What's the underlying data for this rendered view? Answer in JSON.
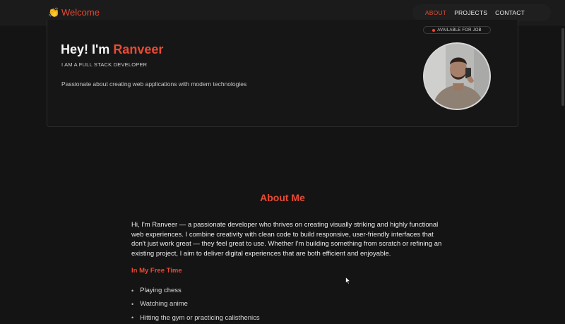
{
  "nav": {
    "brand_icon": "clapping-hands-icon",
    "brand": "Welcome",
    "links": [
      "ABOUT",
      "PROJECTS",
      "CONTACT"
    ],
    "active": "ABOUT"
  },
  "hero": {
    "greeting": "Hey! I'm ",
    "name": "Ranveer",
    "role": "I AM A FULL STACK DEVELOPER",
    "description": "Passionate about creating web applications with modern technologies",
    "badge": "AVAILABLE FOR JOB"
  },
  "about": {
    "heading": "About Me",
    "text": "Hi, I'm Ranveer — a passionate developer who thrives on creating visually striking and highly functional web experiences. I combine creativity with clean code to build responsive, user-friendly interfaces that don't just work great — they feel great to use. Whether I'm building something from scratch or refining an existing project, I aim to deliver digital experiences that are both efficient and enjoyable.",
    "free_time_heading": "In My Free Time",
    "hobbies": [
      "Playing chess",
      "Watching anime",
      "Hitting the gym or practicing calisthenics"
    ]
  },
  "colors": {
    "accent": "#ea4a33",
    "background": "#141414"
  }
}
